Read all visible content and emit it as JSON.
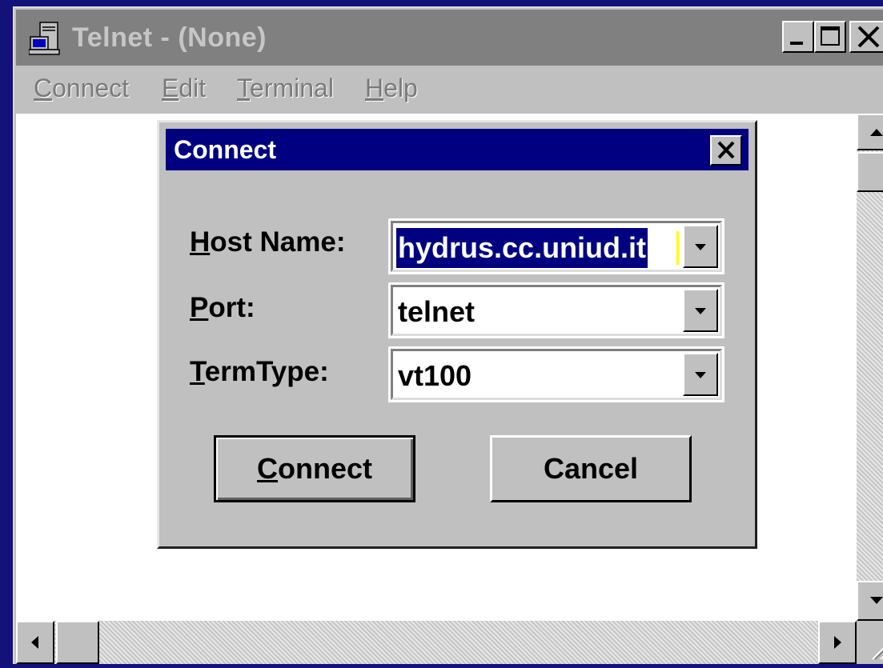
{
  "window": {
    "title": "Telnet - (None)",
    "icon": "telnet-terminal-icon"
  },
  "menu": {
    "items": [
      {
        "label": "Connect",
        "accel": "C",
        "rest": "onnect"
      },
      {
        "label": "Edit",
        "accel": "E",
        "rest": "dit"
      },
      {
        "label": "Terminal",
        "accel": "T",
        "rest": "erminal"
      },
      {
        "label": "Help",
        "accel": "H",
        "rest": "elp"
      }
    ]
  },
  "dialog": {
    "title": "Connect",
    "fields": [
      {
        "label": "Host Name:",
        "accel": "H",
        "rest": "ost Name:",
        "value": "hydrus.cc.uniud.it",
        "selected": true
      },
      {
        "label": "Port:",
        "accel": "P",
        "rest": "ort:",
        "value": "telnet",
        "selected": false
      },
      {
        "label": "TermType:",
        "accel": "T",
        "rest": "ermType:",
        "value": "vt100",
        "selected": false
      }
    ],
    "buttons": {
      "connect": {
        "label": "Connect",
        "accel": "C",
        "rest": "onnect"
      },
      "cancel": {
        "label": "Cancel"
      }
    }
  },
  "colors": {
    "desktop": "#12127a",
    "titlebar_inactive": "#808080",
    "dialog_titlebar": "#000080",
    "face": "#c0c0c0"
  }
}
